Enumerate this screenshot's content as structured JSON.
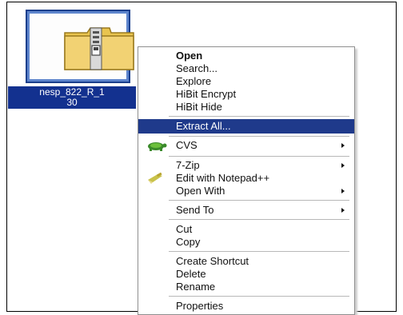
{
  "file": {
    "name_line1": "nesp_822_R_1",
    "name_line2": "30",
    "icon": "zip-folder-icon"
  },
  "menu": {
    "items": [
      {
        "label": "Open"
      },
      {
        "label": "Search..."
      },
      {
        "label": "Explore"
      },
      {
        "label": "HiBit Encrypt"
      },
      {
        "label": "HiBit Hide"
      },
      {
        "label": "Extract All..."
      },
      {
        "label": "CVS"
      },
      {
        "label": "7-Zip"
      },
      {
        "label": "Edit with Notepad++"
      },
      {
        "label": "Open With"
      },
      {
        "label": "Send To"
      },
      {
        "label": "Cut"
      },
      {
        "label": "Copy"
      },
      {
        "label": "Create Shortcut"
      },
      {
        "label": "Delete"
      },
      {
        "label": "Rename"
      },
      {
        "label": "Properties"
      }
    ],
    "icons": {
      "cvs": "tortoise-cvs-icon",
      "notepad": "notepad-plus-plus-icon"
    },
    "highlight_color": "#1f3a8b"
  },
  "colors": {
    "selection": "#13318f",
    "folder": "#e6c25a"
  }
}
